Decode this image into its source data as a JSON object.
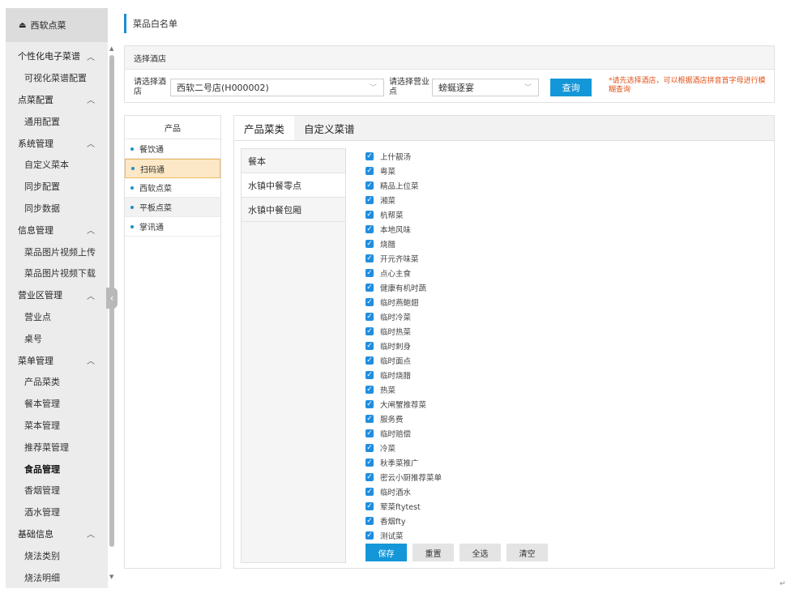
{
  "brand": {
    "title": "西软点菜",
    "icon": "eject-icon"
  },
  "sidebar": {
    "items": [
      {
        "type": "group",
        "label": "个性化电子菜谱"
      },
      {
        "type": "item",
        "label": "可视化菜谱配置"
      },
      {
        "type": "group",
        "label": "点菜配置"
      },
      {
        "type": "item",
        "label": "通用配置"
      },
      {
        "type": "group",
        "label": "系统管理"
      },
      {
        "type": "item",
        "label": "自定义菜本"
      },
      {
        "type": "item",
        "label": "同步配置"
      },
      {
        "type": "item",
        "label": "同步数据"
      },
      {
        "type": "group",
        "label": "信息管理"
      },
      {
        "type": "item",
        "label": "菜品图片视频上传"
      },
      {
        "type": "item",
        "label": "菜品图片视频下载"
      },
      {
        "type": "group",
        "label": "营业区管理"
      },
      {
        "type": "item",
        "label": "营业点"
      },
      {
        "type": "item",
        "label": "桌号"
      },
      {
        "type": "group",
        "label": "菜单管理"
      },
      {
        "type": "item",
        "label": "产品菜类"
      },
      {
        "type": "item",
        "label": "餐本管理"
      },
      {
        "type": "item",
        "label": "菜本管理"
      },
      {
        "type": "item",
        "label": "推荐菜管理"
      },
      {
        "type": "item",
        "label": "食品管理",
        "active": true
      },
      {
        "type": "item",
        "label": "香烟管理"
      },
      {
        "type": "item",
        "label": "酒水管理"
      },
      {
        "type": "group",
        "label": "基础信息"
      },
      {
        "type": "item",
        "label": "烧法类别"
      },
      {
        "type": "item",
        "label": "烧法明细"
      }
    ]
  },
  "page": {
    "title": "菜品白名单"
  },
  "hotel_panel": {
    "heading": "选择酒店",
    "hotel_label": "请选择酒店",
    "hotel_value": "西软二号店(H000002)",
    "point_label": "请选择营业点",
    "point_value": "螃蜒逐宴",
    "query_label": "查询",
    "hint": "*请先选择酒店，可以根据酒店拼音首字母进行模糊查询"
  },
  "product_panel": {
    "heading": "产品",
    "items": [
      "餐饮通",
      "扫码通",
      "西软点菜",
      "平板点菜",
      "掌讯通"
    ],
    "active_index": 1
  },
  "category_panel": {
    "tabs": [
      "产品菜类",
      "自定义菜谱"
    ],
    "active_tab": 0,
    "menus": [
      "餐本",
      "水镇中餐零点",
      "水镇中餐包厢"
    ],
    "active_menu": 1,
    "categories": [
      "上什靓汤",
      "粤菜",
      "精品上位菜",
      "湘菜",
      "杭帮菜",
      "本地风味",
      "烧腊",
      "开元齐味菜",
      "点心主食",
      "健康有机时蔬",
      "临时燕鲍翅",
      "临时冷菜",
      "临时热菜",
      "临时刺身",
      "临时面点",
      "临时烧腊",
      "热菜",
      "大闸蟹推荐菜",
      "服务费",
      "临时赔偿",
      "冷菜",
      "秋季菜推广",
      "密云小厨推荐菜单",
      "临时酒水",
      "荤菜ftytest",
      "香烟fty",
      "测试菜"
    ],
    "buttons": {
      "save": "保存",
      "reset": "重置",
      "select_all": "全选",
      "clear": "清空"
    }
  },
  "colors": {
    "accent": "#1497d8",
    "hint": "#e0531b",
    "active_product_bg": "#fce8c6",
    "checkbox": "#1f8ee0"
  }
}
